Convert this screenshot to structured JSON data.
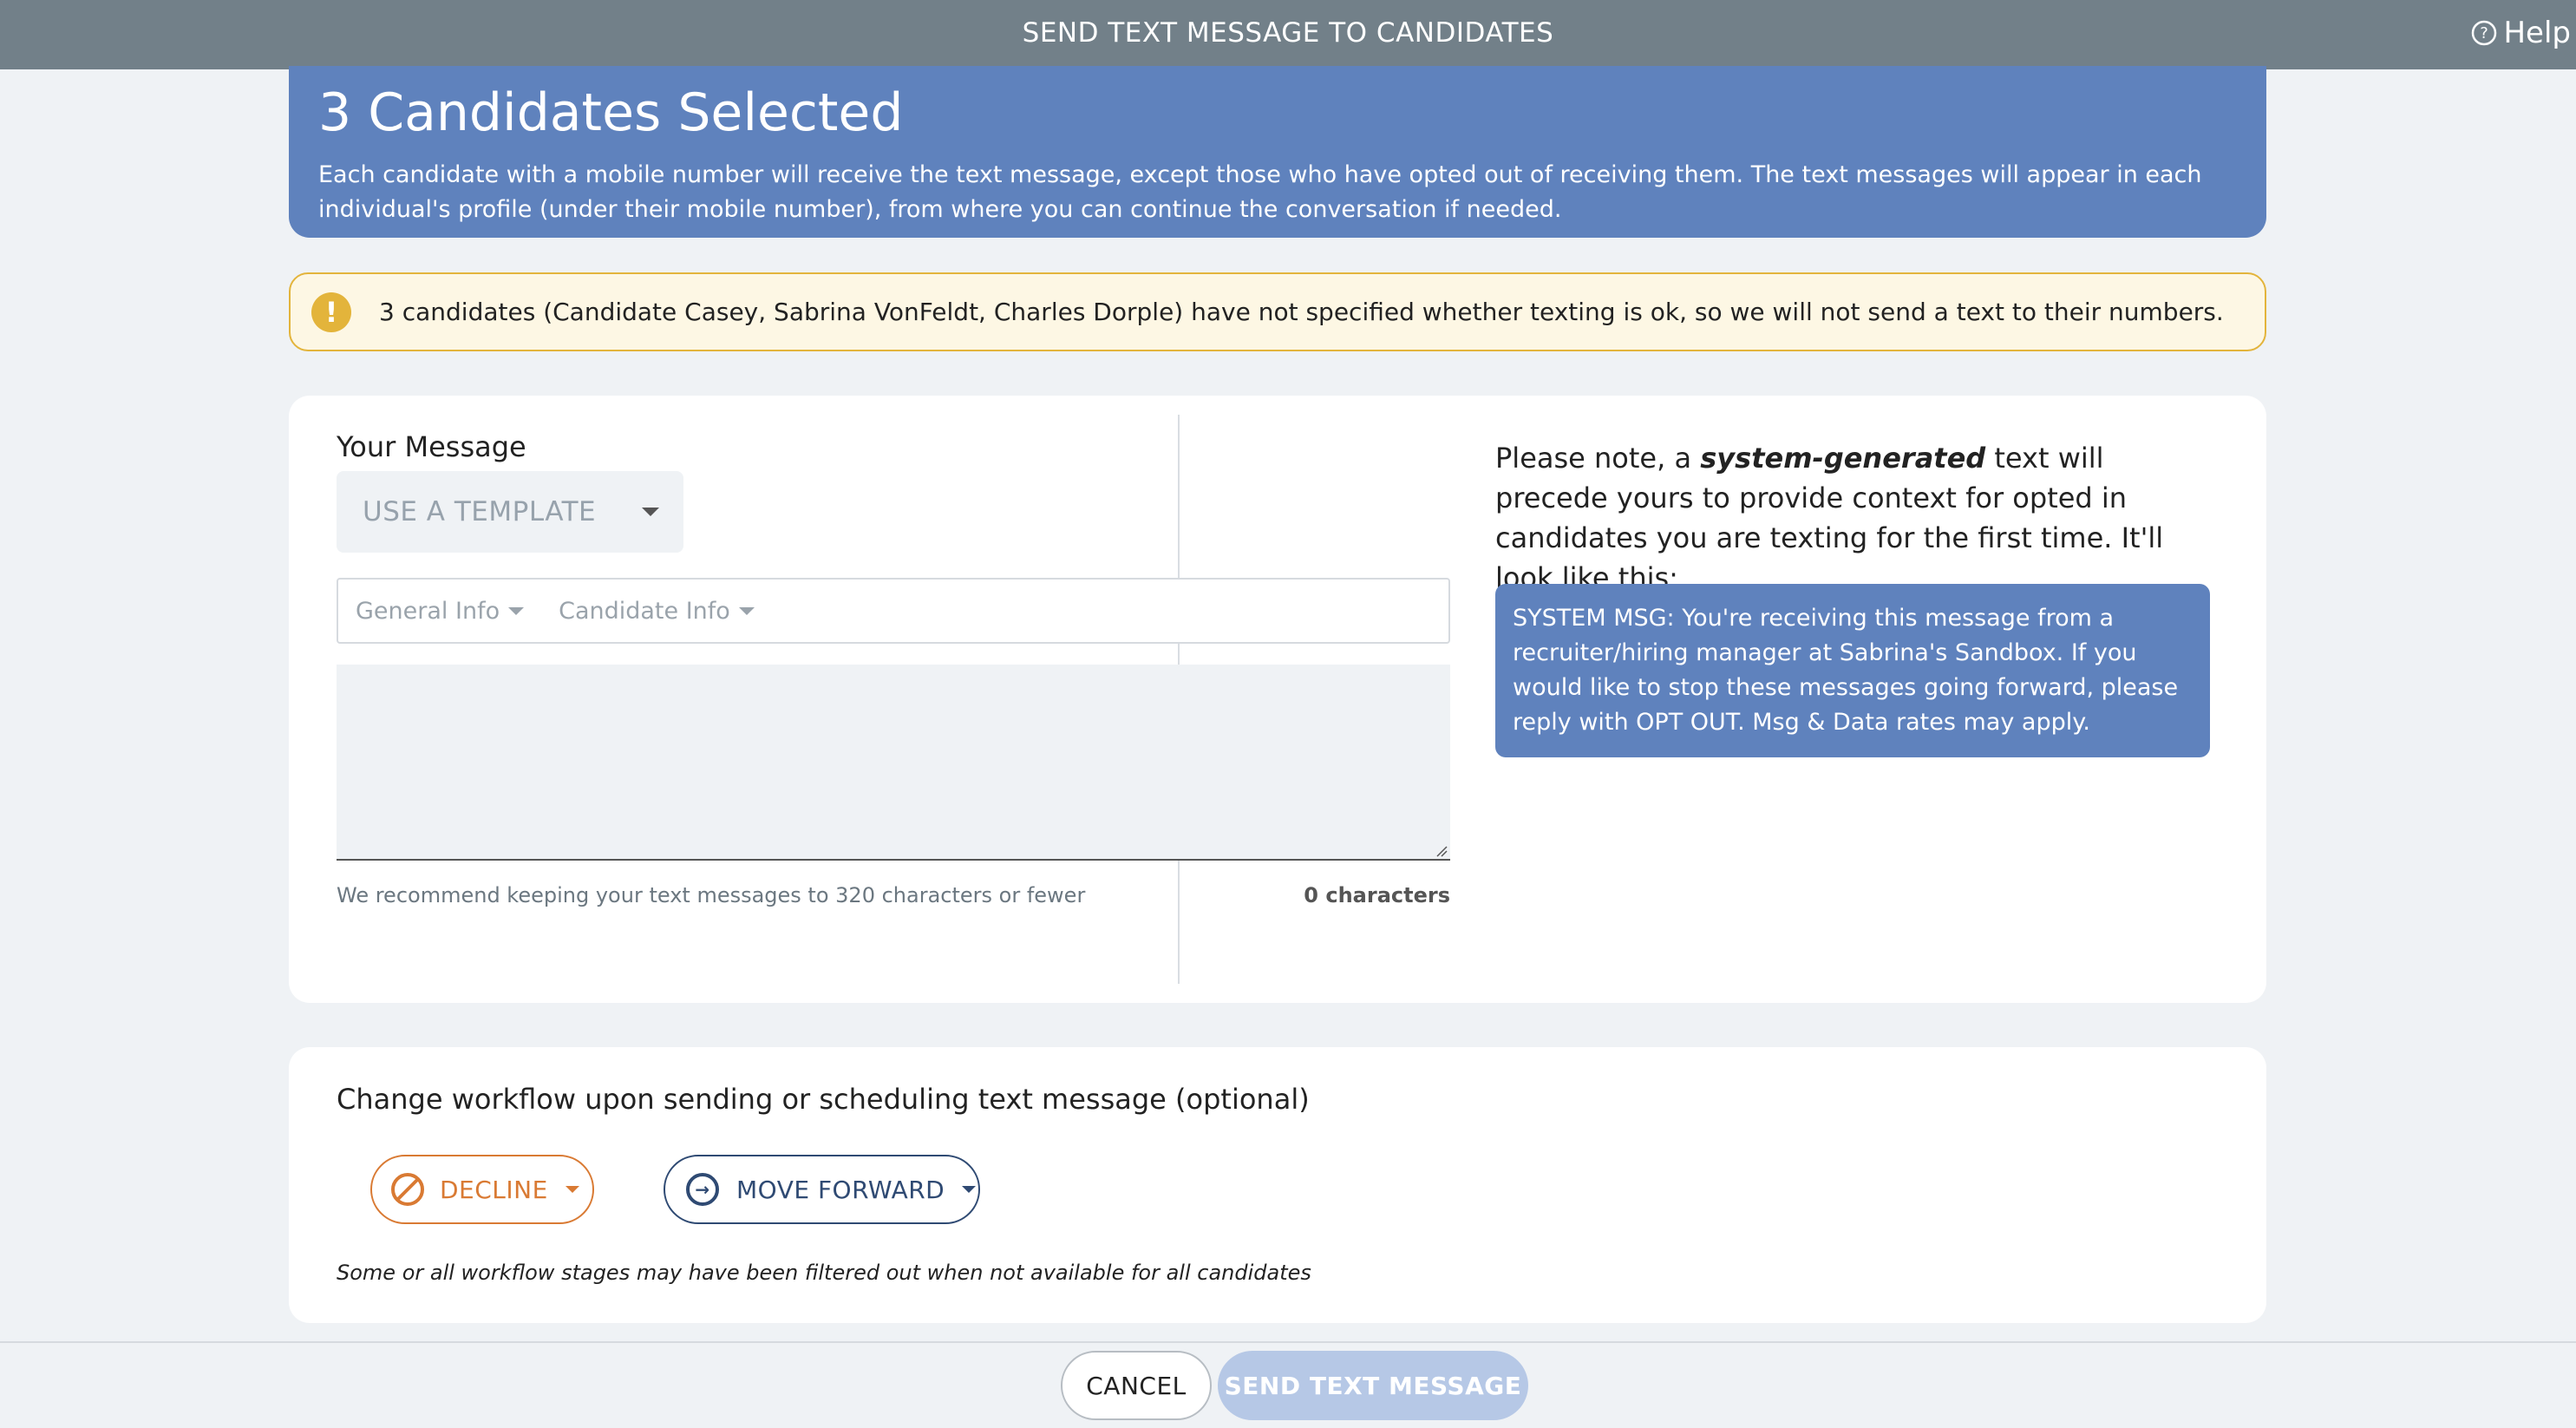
{
  "header": {
    "title": "SEND TEXT MESSAGE TO CANDIDATES",
    "help_label": "Help"
  },
  "banner": {
    "heading": "3 Candidates Selected",
    "description": "Each candidate with a mobile number will receive the text message, except those who have opted out of receiving them. The text messages will appear in each individual's profile (under their mobile number), from where you can continue the conversation if needed."
  },
  "alert": {
    "icon": "exclamation-icon",
    "text": "3 candidates (Candidate Casey, Sabrina VonFeldt, Charles Dorple) have not specified whether texting is ok, so we will not send a text to their numbers."
  },
  "message": {
    "label": "Your Message",
    "template_label": "USE A TEMPLATE",
    "tokens": [
      "General Info",
      "Candidate Info"
    ],
    "body_value": "",
    "recommendation": "We recommend keeping your text messages to 320 characters or fewer",
    "char_count": "0 characters"
  },
  "note": {
    "prefix": "Please note, a ",
    "emphasis": "system-generated",
    "suffix": " text will precede yours to provide context for opted in candidates you are texting for the first time. It'll look like this:",
    "system_message": "SYSTEM MSG: You're receiving this message from a recruiter/hiring manager at Sabrina's Sandbox. If you would like to stop these messages going forward, please reply with OPT OUT. Msg & Data rates may apply."
  },
  "workflow": {
    "title": "Change workflow upon sending or scheduling text message (optional)",
    "decline_label": "DECLINE",
    "forward_label": "MOVE FORWARD",
    "note": "Some or all workflow stages may have been filtered out when not available for all candidates"
  },
  "footer": {
    "cancel_label": "CANCEL",
    "send_label": "SEND TEXT MESSAGE"
  },
  "colors": {
    "topbar": "#728089",
    "banner": "#5f82bd",
    "alert_border": "#e3b43b",
    "decline": "#d97a33",
    "forward": "#2f4a73",
    "send_disabled": "#b6c8e6"
  }
}
